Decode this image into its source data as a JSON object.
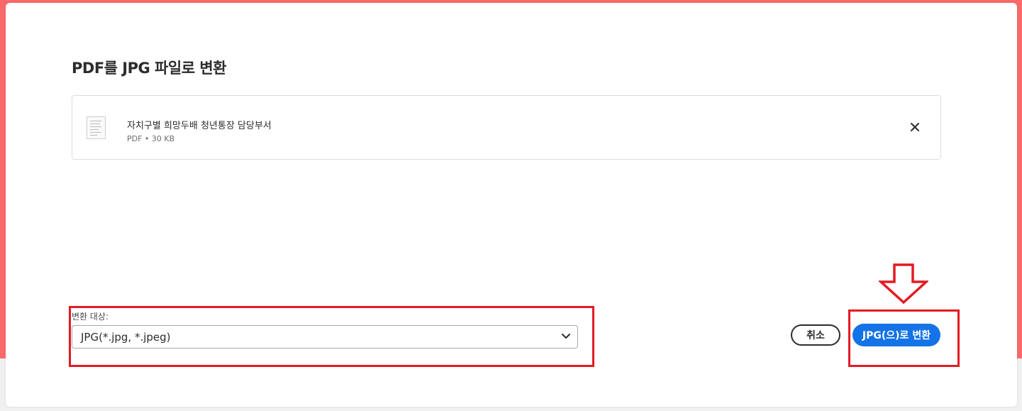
{
  "dialog": {
    "title": "PDF를 JPG 파일로 변환"
  },
  "file": {
    "name": "자치구별 희망두배 청년통장 담당부서",
    "meta": "PDF • 30 KB"
  },
  "convert_target": {
    "label": "변환 대상:",
    "selected": "JPG(*.jpg, *.jpeg)"
  },
  "actions": {
    "cancel_label": "취소",
    "convert_label": "JPG(으)로 변환"
  },
  "colors": {
    "background_accent": "#fb6a6a",
    "primary_button": "#1473e6",
    "highlight": "#e31b23"
  },
  "icons": {
    "file": "pdf-file-thumbnail-icon",
    "remove": "close-icon",
    "dropdown": "chevron-down-icon",
    "annotation": "down-arrow-outline"
  }
}
